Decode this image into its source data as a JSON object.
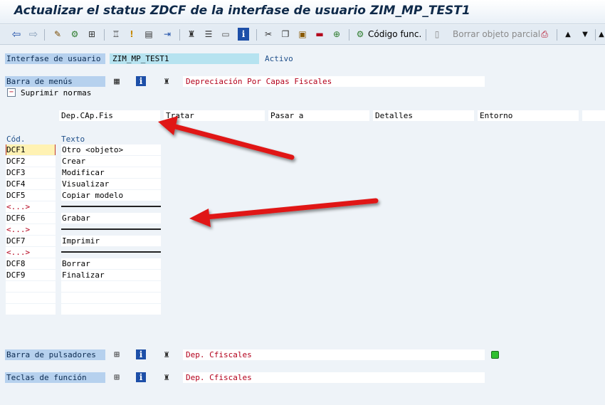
{
  "window": {
    "title": "Actualizar el status ZDCF de la interfase de usuario ZIM_MP_TEST1"
  },
  "toolbar": {
    "icons": [
      "back-icon",
      "forward-icon",
      "pencil-glasses-icon",
      "object-icon",
      "hierarchy-icon",
      "activate-icon",
      "where-used-icon",
      "layout-icon",
      "navigate-icon",
      "tree-icon",
      "print-structure-icon",
      "window-icon",
      "info-icon",
      "cut-icon",
      "copy-icon",
      "paste-icon",
      "delete-icon",
      "insert-icon"
    ],
    "function_code_label": "Código func.",
    "partial_delete_label": "Borrar objeto parcial"
  },
  "interface": {
    "label": "Interfase de usuario",
    "value": "ZIM_MP_TEST1",
    "status": "Activo"
  },
  "menu_bar": {
    "label": "Barra de menús",
    "description": "Depreciación Por Capas Fiscales",
    "suppress_label": "Suprimir normas",
    "menus": [
      "Dep.CAp.Fis",
      "Tratar",
      "Pasar a",
      "Detalles",
      "Entorno",
      ""
    ]
  },
  "function_list": {
    "col_code": "Cód.",
    "col_text": "Texto",
    "rows": [
      {
        "code": "DCF1",
        "text": "Otro <objeto>",
        "type": "item"
      },
      {
        "code": "DCF2",
        "text": "Crear",
        "type": "item"
      },
      {
        "code": "DCF3",
        "text": "Modificar",
        "type": "item"
      },
      {
        "code": "DCF4",
        "text": "Visualizar",
        "type": "item"
      },
      {
        "code": "DCF5",
        "text": "Copiar modelo",
        "type": "item"
      },
      {
        "code": "<...>",
        "text": "",
        "type": "separator"
      },
      {
        "code": "DCF6",
        "text": "Grabar",
        "type": "item"
      },
      {
        "code": "<...>",
        "text": "",
        "type": "separator"
      },
      {
        "code": "DCF7",
        "text": "Imprimir",
        "type": "item"
      },
      {
        "code": "<...>",
        "text": "",
        "type": "separator"
      },
      {
        "code": "DCF8",
        "text": "Borrar",
        "type": "item"
      },
      {
        "code": "DCF9",
        "text": "Finalizar",
        "type": "item"
      },
      {
        "code": "",
        "text": "",
        "type": "empty"
      },
      {
        "code": "",
        "text": "",
        "type": "empty"
      },
      {
        "code": "",
        "text": "",
        "type": "empty"
      }
    ]
  },
  "pushbutton_bar": {
    "label": "Barra de pulsadores",
    "description": "Dep. Cfiscales",
    "status_color": "#2fbf2f"
  },
  "function_keys": {
    "label": "Teclas de función",
    "description": "Dep. Cfiscales"
  },
  "colors": {
    "label_bg": "#b6d1ee",
    "arrow": "#e01818",
    "red_text": "#b3001b"
  }
}
